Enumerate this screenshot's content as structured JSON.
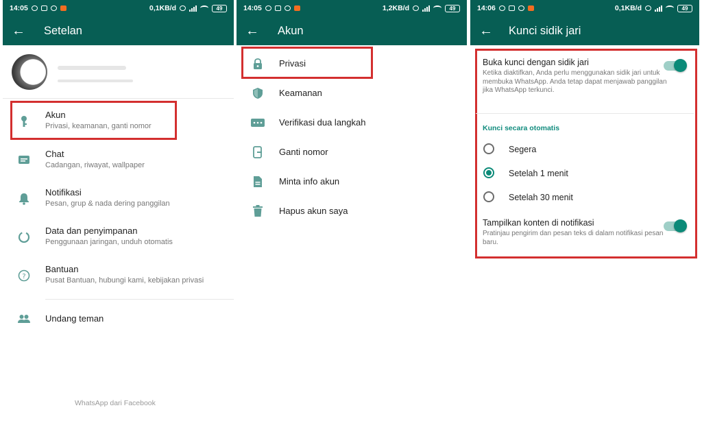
{
  "panel1": {
    "status": {
      "time": "14:05",
      "speed": "0,1KB/d",
      "battery": "49"
    },
    "title": "Setelan",
    "items": [
      {
        "title": "Akun",
        "subtitle": "Privasi, keamanan, ganti nomor",
        "icon": "key-icon"
      },
      {
        "title": "Chat",
        "subtitle": "Cadangan, riwayat, wallpaper",
        "icon": "chat-icon"
      },
      {
        "title": "Notifikasi",
        "subtitle": "Pesan, grup & nada dering panggilan",
        "icon": "bell-icon"
      },
      {
        "title": "Data dan penyimpanan",
        "subtitle": "Penggunaan jaringan, unduh otomatis",
        "icon": "data-usage-icon"
      },
      {
        "title": "Bantuan",
        "subtitle": "Pusat Bantuan, hubungi kami, kebijakan privasi",
        "icon": "help-icon"
      },
      {
        "title": "Undang teman",
        "icon": "people-icon"
      }
    ],
    "footer": "WhatsApp dari Facebook"
  },
  "panel2": {
    "status": {
      "time": "14:05",
      "speed": "1,2KB/d",
      "battery": "49"
    },
    "title": "Akun",
    "items": [
      {
        "title": "Privasi",
        "icon": "lock-icon"
      },
      {
        "title": "Keamanan",
        "icon": "shield-icon"
      },
      {
        "title": "Verifikasi dua langkah",
        "icon": "dots-icon"
      },
      {
        "title": "Ganti nomor",
        "icon": "phone-change-icon"
      },
      {
        "title": "Minta info akun",
        "icon": "document-icon"
      },
      {
        "title": "Hapus akun saya",
        "icon": "trash-icon"
      }
    ]
  },
  "panel3": {
    "status": {
      "time": "14:06",
      "speed": "0,1KB/d",
      "battery": "49"
    },
    "title": "Kunci sidik jari",
    "unlock": {
      "title": "Buka kunci dengan sidik jari",
      "desc": "Ketika diaktifkan, Anda perlu menggunakan sidik jari untuk membuka WhatsApp. Anda tetap dapat menjawab panggilan jika WhatsApp terkunci.",
      "enabled": true
    },
    "section": "Kunci secara otomatis",
    "options": [
      {
        "label": "Segera",
        "selected": false
      },
      {
        "label": "Setelah 1 menit",
        "selected": true
      },
      {
        "label": "Setelah 30 menit",
        "selected": false
      }
    ],
    "notif": {
      "title": "Tampilkan konten di notifikasi",
      "desc": "Pratinjau pengirim dan pesan teks di dalam notifikasi pesan baru.",
      "enabled": true
    }
  },
  "colors": {
    "header": "#075e54",
    "accent": "#0b8a78",
    "highlight": "#d32f2f"
  }
}
